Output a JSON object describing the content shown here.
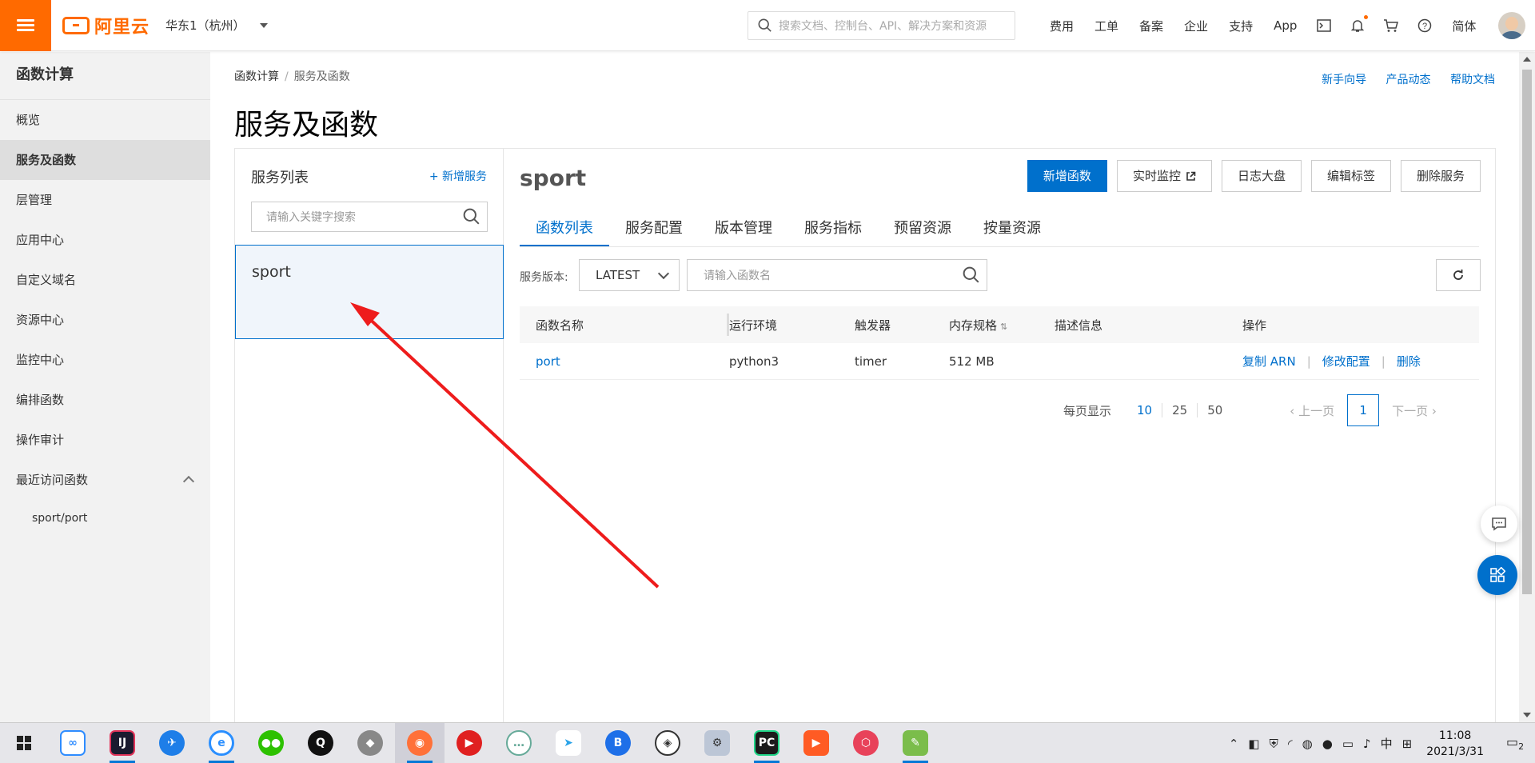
{
  "topbar": {
    "logo_text": "阿里云",
    "region": "华东1（杭州）",
    "search_placeholder": "搜索文档、控制台、API、解决方案和资源",
    "links": [
      "费用",
      "工单",
      "备案",
      "企业",
      "支持",
      "App"
    ],
    "lang": "简体"
  },
  "sidebar": {
    "title": "函数计算",
    "items": [
      "概览",
      "服务及函数",
      "层管理",
      "应用中心",
      "自定义域名",
      "资源中心",
      "监控中心",
      "编排函数",
      "操作审计",
      "最近访问函数"
    ],
    "active_index": 1,
    "recent": [
      "sport/port"
    ]
  },
  "main": {
    "breadcrumb": [
      "函数计算",
      "服务及函数"
    ],
    "help_links": [
      "新手向导",
      "产品动态",
      "帮助文档"
    ],
    "page_title": "服务及函数",
    "service_list": {
      "heading": "服务列表",
      "add_label": "+ 新增服务",
      "search_placeholder": "请输入关键字搜索",
      "items": [
        "sport"
      ]
    },
    "service": {
      "name": "sport",
      "buttons": [
        "新增函数",
        "实时监控",
        "日志大盘",
        "编辑标签",
        "删除服务"
      ],
      "tabs": [
        "函数列表",
        "服务配置",
        "版本管理",
        "服务指标",
        "预留资源",
        "按量资源"
      ],
      "active_tab": 0,
      "version_label": "服务版本:",
      "version_value": "LATEST",
      "fn_search_placeholder": "请输入函数名"
    },
    "table": {
      "headers": [
        "函数名称",
        "运行环境",
        "触发器",
        "内存规格",
        "描述信息",
        "操作"
      ],
      "rows": [
        {
          "name": "port",
          "runtime": "python3",
          "trigger": "timer",
          "memory": "512 MB",
          "desc": "",
          "ops": [
            "复制 ARN",
            "修改配置",
            "删除"
          ]
        }
      ]
    },
    "pagination": {
      "per_page_label": "每页显示",
      "sizes": [
        "10",
        "25",
        "50"
      ],
      "prev": "上一页",
      "next": "下一页",
      "current": "1"
    }
  },
  "taskbar": {
    "time": "11:08",
    "date": "2021/3/31",
    "ime": "中",
    "notifications": "2"
  },
  "colors": {
    "brand": "#ff6a00",
    "primary": "#0070cc",
    "annotation_arrow": "#ee1c1c"
  }
}
